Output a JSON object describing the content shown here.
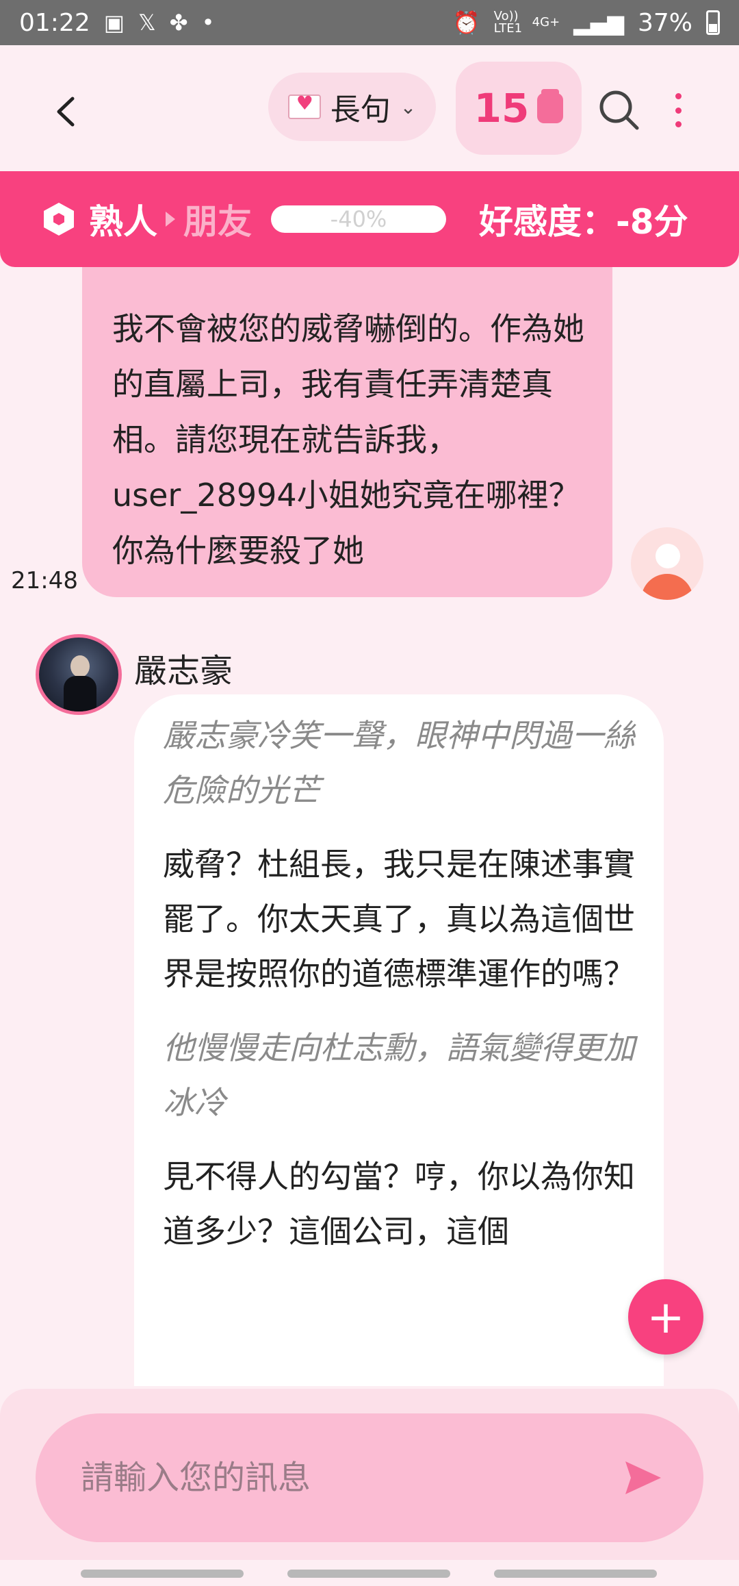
{
  "status_bar": {
    "time": "01:22",
    "battery": "37%",
    "icons": [
      "gallery-icon",
      "x-icon",
      "pinwheel-icon",
      "alarm-icon",
      "volte-icon",
      "4g-icon",
      "signal-icon",
      "battery-icon"
    ],
    "volte_label": "Vo)) LTE1",
    "network_label": "4G+"
  },
  "header": {
    "mode_label": "長句",
    "count": "15"
  },
  "affection": {
    "from_level": "熟人",
    "to_level": "朋友",
    "progress_label": "-40%",
    "progress_value": -40,
    "score_label": "好感度：-8分"
  },
  "messages": {
    "user": {
      "text": "我不會被您的威脅嚇倒的。作為她的直屬上司，我有責任弄清楚真相。請您現在就告訴我，user_28994小姐她究竟在哪裡？你為什麼要殺了她",
      "time": "21:48"
    },
    "bot": {
      "name": "嚴志豪",
      "narration_1": "嚴志豪冷笑一聲，眼神中閃過一絲危險的光芒",
      "speech_1": "威脅？杜組長，我只是在陳述事實罷了。你太天真了，真以為這個世界是按照你的道德標準運作的嗎？",
      "narration_2": "他慢慢走向杜志勳，語氣變得更加冰冷",
      "speech_2": "見不得人的勾當？哼，你以為你知道多少？這個公司，這個"
    }
  },
  "input": {
    "placeholder": "請輸入您的訊息"
  },
  "colors": {
    "accent": "#f8417f",
    "user_bubble": "#fbbcd3",
    "background": "#fdeef3"
  }
}
